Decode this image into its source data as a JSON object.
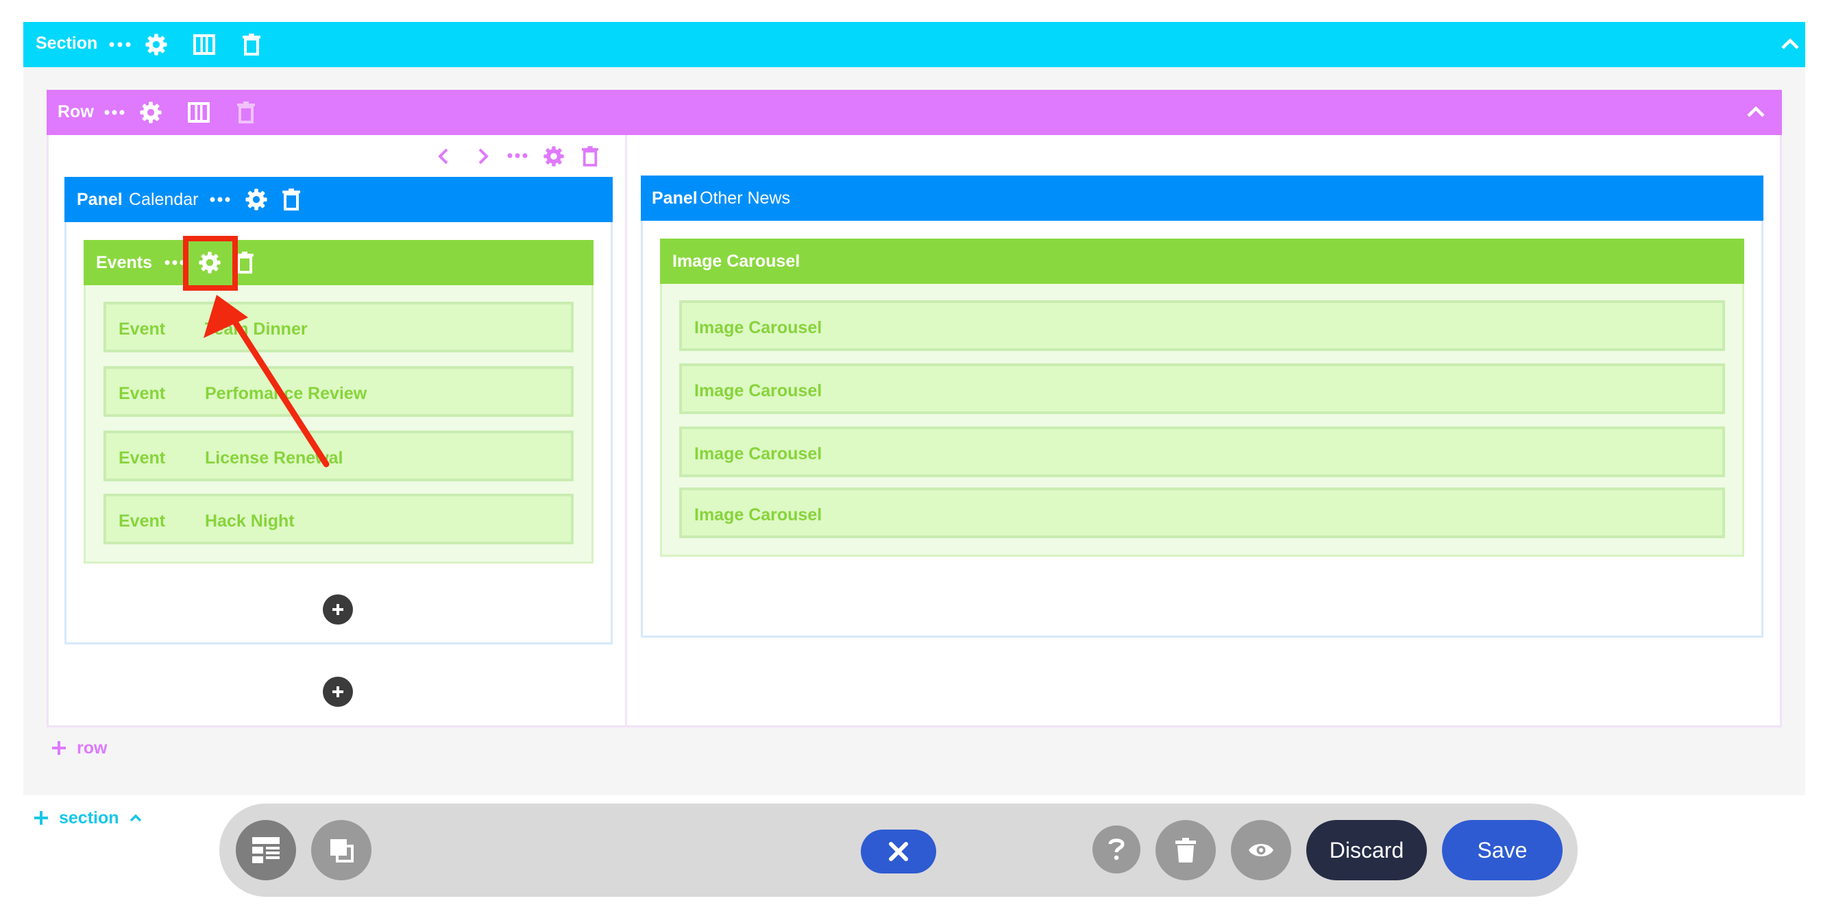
{
  "section": {
    "label": "Section",
    "add_label": "section"
  },
  "row": {
    "label": "Row",
    "add_label": "row"
  },
  "panel_left": {
    "label": "Panel",
    "title": "Calendar"
  },
  "panel_right": {
    "label": "Panel",
    "title": "Other News"
  },
  "events": {
    "label": "Events",
    "items": [
      {
        "type": "Event",
        "title": "Team Dinner"
      },
      {
        "type": "Event",
        "title": "Perfomance Review"
      },
      {
        "type": "Event",
        "title": "License Renewal"
      },
      {
        "type": "Event",
        "title": "Hack Night"
      }
    ]
  },
  "carousel": {
    "label": "Image Carousel",
    "items": [
      "Image Carousel",
      "Image Carousel",
      "Image Carousel",
      "Image Carousel"
    ]
  },
  "toolbar": {
    "discard_label": "Discard",
    "save_label": "Save"
  },
  "icons": {
    "more": "more-icon",
    "settings": "gear-icon",
    "columns": "columns-icon",
    "delete": "trash-icon",
    "collapse": "chevron-up-icon",
    "prev": "chevron-left-icon",
    "next": "chevron-right-icon",
    "add": "plus-icon",
    "layout": "layout-icon",
    "duplicate": "duplicate-icon",
    "close": "close-icon",
    "help": "help-icon",
    "preview": "eye-icon"
  },
  "colors": {
    "section": "#02d8fc",
    "row": "#df79fd",
    "panel": "#008ffa",
    "green": "#8ad83f",
    "discard": "#262c44",
    "save": "#2e5bd2",
    "close": "#2e5bd2",
    "annotation": "#f1290f"
  }
}
